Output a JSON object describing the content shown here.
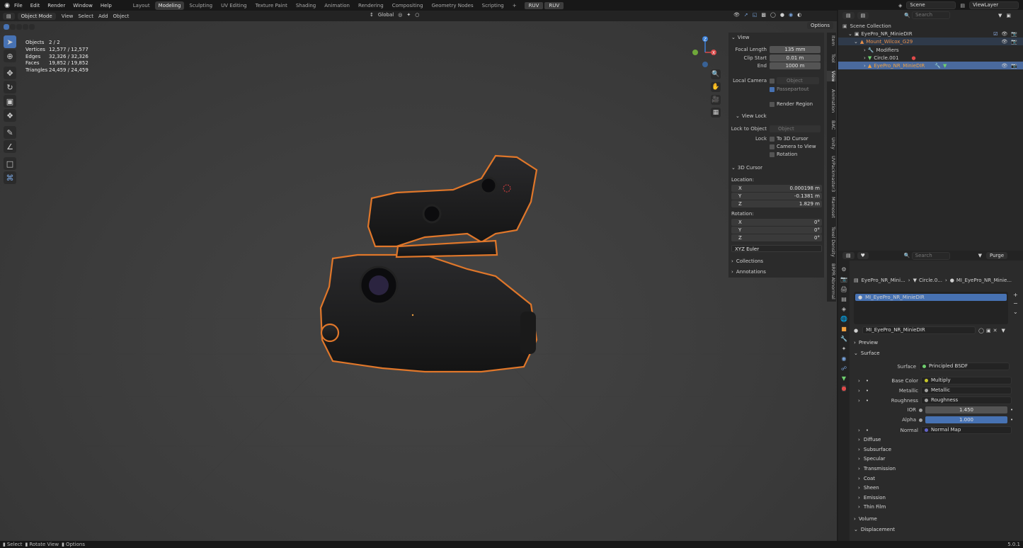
{
  "topbar": {
    "menus": [
      "File",
      "Edit",
      "Render",
      "Window",
      "Help"
    ],
    "workspaces": [
      "Layout",
      "Modeling",
      "Sculpting",
      "UV Editing",
      "Texture Paint",
      "Shading",
      "Animation",
      "Rendering",
      "Compositing",
      "Geometry Nodes",
      "Scripting"
    ],
    "active_workspace": "Modeling",
    "ruv": [
      "RUV",
      "RUV"
    ],
    "scene": "Scene",
    "view_layer": "ViewLayer"
  },
  "viewport_header": {
    "mode": "Object Mode",
    "menus": [
      "View",
      "Select",
      "Add",
      "Object"
    ],
    "orientation": "Global",
    "options": "Options"
  },
  "stats": [
    {
      "k": "Objects",
      "v": "2 / 2"
    },
    {
      "k": "Vertices",
      "v": "12,577 / 12,577"
    },
    {
      "k": "Edges",
      "v": "32,326 / 32,326"
    },
    {
      "k": "Faces",
      "v": "19,852 / 19,852"
    },
    {
      "k": "Triangles",
      "v": "24,459 / 24,459"
    }
  ],
  "gizmo": {
    "z": "Z",
    "x": "X"
  },
  "npanel": {
    "view_title": "View",
    "focal_length_label": "Focal Length",
    "focal_length": "135 mm",
    "clip_start_label": "Clip Start",
    "clip_start": "0.01 m",
    "end_label": "End",
    "end": "1000 m",
    "local_camera_label": "Local Camera",
    "object_placeholder": "Object",
    "passepartout": "Passepartout",
    "render_region": "Render Region",
    "view_lock_title": "View Lock",
    "lock_to_object_label": "Lock to Object",
    "lock_label": "Lock",
    "to_3d_cursor": "To 3D Cursor",
    "camera_to_view": "Camera to View",
    "rotation_chk": "Rotation",
    "cursor_title": "3D Cursor",
    "location_label": "Location:",
    "loc": [
      {
        "a": "X",
        "v": "0.000198 m"
      },
      {
        "a": "Y",
        "v": "-0.1381 m"
      },
      {
        "a": "Z",
        "v": "1.829 m"
      }
    ],
    "rotation_label": "Rotation:",
    "rot": [
      {
        "a": "X",
        "v": "0°"
      },
      {
        "a": "Y",
        "v": "0°"
      },
      {
        "a": "Z",
        "v": "0°"
      }
    ],
    "rot_mode": "XYZ Euler",
    "collections": "Collections",
    "annotations": "Annotations"
  },
  "side_tabs": [
    "Item",
    "Tool",
    "View",
    "Animation",
    "BAC",
    "Unity",
    "UVPackmaster3",
    "Mamoset",
    "Texel Density",
    "BRPR Abnormal"
  ],
  "outliner": {
    "search_placeholder": "Search",
    "rows": [
      {
        "label": "Scene Collection",
        "color": "#d8d8d8"
      },
      {
        "label": "EyePro_NR_MinieDIR",
        "color": "#d8d8d8"
      },
      {
        "label": "Mount_Wilcox_G29",
        "color": "#e8904a"
      },
      {
        "label": "Modifiers",
        "color": "#cfcfcf"
      },
      {
        "label": "Circle.001",
        "color": "#cfcfcf"
      },
      {
        "label": "EyePro_NR_MinieDIR",
        "color": "#f0a040"
      }
    ]
  },
  "props": {
    "search_placeholder": "Search",
    "purge": "Purge",
    "crumbs": [
      "EyePro_NR_Mini...",
      "Circle.0...",
      "MI_EyePro_NR_Minie..."
    ],
    "slot": "MI_EyePro_NR_MinieDIR",
    "material": "MI_EyePro_NR_MinieDIR",
    "preview": "Preview",
    "surface": "Surface",
    "surface_label": "Surface",
    "surface_value": "Principled BSDF",
    "inputs": [
      {
        "label": "Base Color",
        "value": "Multiply",
        "dot": "#c7c729"
      },
      {
        "label": "Metallic",
        "value": "Metallic",
        "dot": "#a1a1a1"
      },
      {
        "label": "Roughness",
        "value": "Roughness",
        "dot": "#a1a1a1"
      }
    ],
    "ior_label": "IOR",
    "ior": "1.450",
    "alpha_label": "Alpha",
    "alpha": "1.000",
    "normal_label": "Normal",
    "normal": "Normal Map",
    "subsections": [
      "Diffuse",
      "Subsurface",
      "Specular",
      "Transmission",
      "Coat",
      "Sheen",
      "Emission",
      "Thin Film"
    ],
    "volume": "Volume",
    "displacement": "Displacement"
  },
  "statusbar": {
    "items": [
      "Select",
      "Rotate View",
      "Options"
    ],
    "version": "5.0.1"
  }
}
